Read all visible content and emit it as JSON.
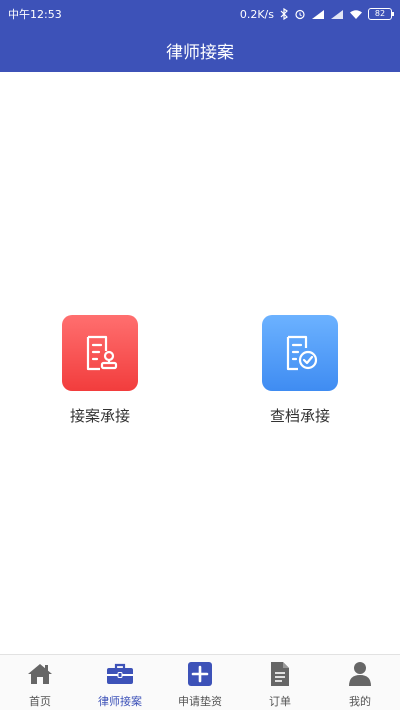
{
  "status_bar": {
    "time": "中午12:53",
    "speed": "0.2K/s",
    "battery": "82"
  },
  "header": {
    "title": "律师接案"
  },
  "main": {
    "tiles": [
      {
        "label": "接案承接",
        "icon": "document-stamp-icon",
        "color": "#f24848"
      },
      {
        "label": "查档承接",
        "icon": "document-check-icon",
        "color": "#4a94f4"
      }
    ]
  },
  "bottom_nav": {
    "items": [
      {
        "label": "首页",
        "icon": "home-icon",
        "active": false
      },
      {
        "label": "律师接案",
        "icon": "briefcase-icon",
        "active": true
      },
      {
        "label": "申请垫资",
        "icon": "plus-box-icon",
        "active": false
      },
      {
        "label": "订单",
        "icon": "document-icon",
        "active": false
      },
      {
        "label": "我的",
        "icon": "user-icon",
        "active": false
      }
    ]
  },
  "colors": {
    "brand": "#3d52b8",
    "tile_red": "#f24848",
    "tile_blue": "#4a94f4",
    "nav_inactive": "#555555"
  }
}
